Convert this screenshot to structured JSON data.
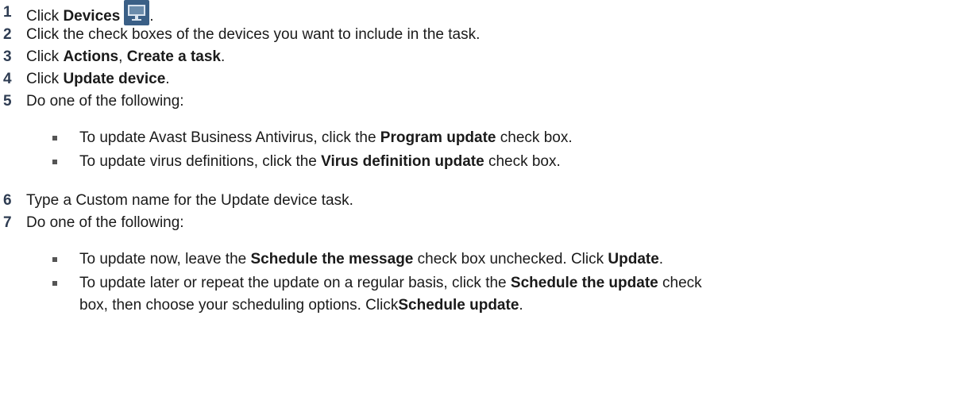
{
  "steps": [
    {
      "num": "1",
      "pre": "Click ",
      "b1": "Devices",
      "post": "."
    },
    {
      "num": "2",
      "text": "Click the check boxes of the devices you want to include in the task."
    },
    {
      "num": "3",
      "pre": "Click ",
      "b1": "Actions",
      "mid": ", ",
      "b2": "Create a task",
      "post": "."
    },
    {
      "num": "4",
      "pre": "Click ",
      "b1": "Update device",
      "post": "."
    },
    {
      "num": "5",
      "text": "Do one of the following:"
    },
    {
      "num": "6",
      "text": "Type a Custom name for the Update device task."
    },
    {
      "num": "7",
      "text": "Do one of the following:"
    }
  ],
  "step5_bullets": [
    {
      "pre": "To update Avast Business Antivirus, click the ",
      "b1": "Program update",
      "post": " check box."
    },
    {
      "pre": "To update virus definitions, click the ",
      "b1": "Virus definition update",
      "post": " check box."
    }
  ],
  "step7_bullets": [
    {
      "pre": "To update now, leave the ",
      "b1": "Schedule the message",
      "mid": " check box unchecked. Click ",
      "b2": "Update",
      "post": "."
    },
    {
      "pre": "To update later or repeat the update on a regular basis, click the ",
      "b1": "Schedule the update",
      "post": " check",
      "cont_text": "box, then choose your scheduling options. Click ",
      "cont_b": "Schedule update",
      "cont_post": "."
    }
  ],
  "icons": {
    "devices": "monitor-icon"
  },
  "colors": {
    "step_number": "#2e3c52",
    "icon_bg": "#3a5f86",
    "bullet": "#555555"
  }
}
